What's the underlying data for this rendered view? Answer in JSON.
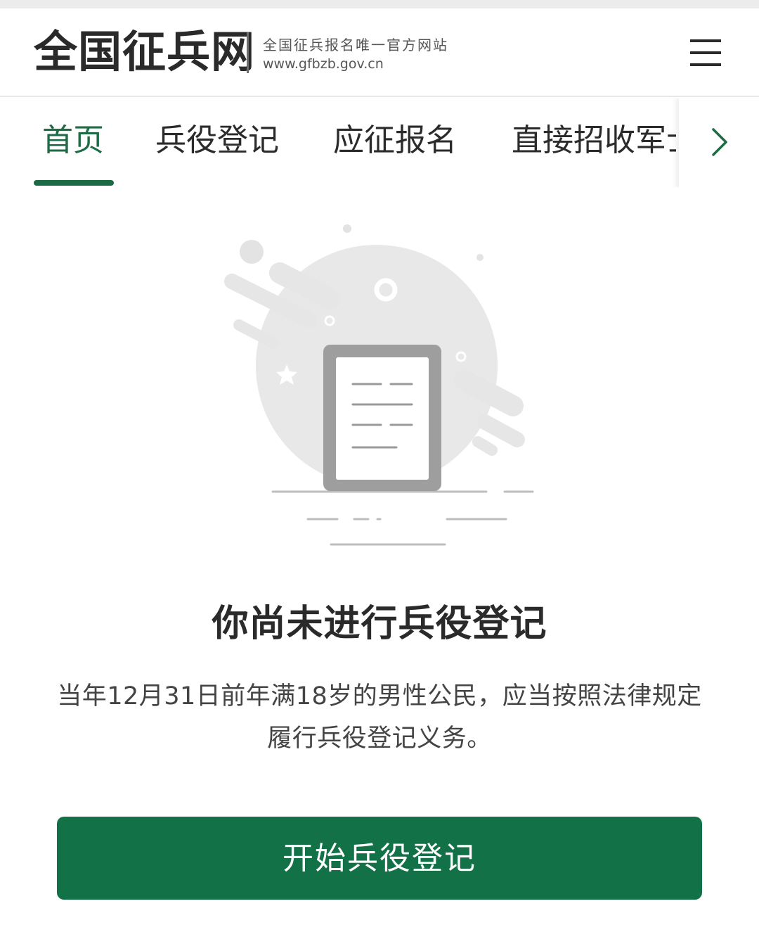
{
  "header": {
    "site_title": "全国征兵网",
    "tagline": "全国征兵报名唯一官方网站",
    "url": "www.gfbzb.gov.cn",
    "menu_icon": "hamburger-menu-icon"
  },
  "tabs": {
    "items": [
      {
        "label": "首页",
        "active": true
      },
      {
        "label": "兵役登记",
        "active": false
      },
      {
        "label": "应征报名",
        "active": false
      },
      {
        "label": "直接招收军士",
        "active": false
      }
    ],
    "next_icon": "chevron-right-icon"
  },
  "empty_state": {
    "illustration": "empty-document-illustration",
    "title": "你尚未进行兵役登记",
    "description": "当年12月31日前年满18岁的男性公民，应当按照法律规定履行兵役登记义务。"
  },
  "action": {
    "start_label": "开始兵役登记"
  },
  "colors": {
    "brand_green": "#127146",
    "active_tab": "#1f6b46",
    "text_dark": "#2a2a2a",
    "text_secondary": "#444444"
  }
}
